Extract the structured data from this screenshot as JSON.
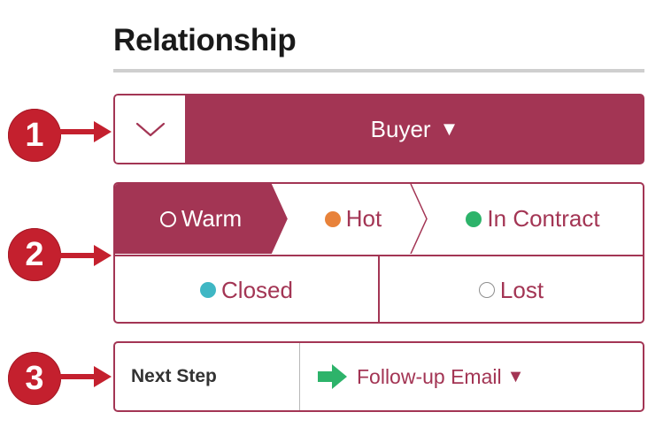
{
  "section": {
    "title": "Relationship"
  },
  "callouts": [
    "1",
    "2",
    "3"
  ],
  "relationship": {
    "role_label": "Buyer",
    "role_caret": "▼"
  },
  "status": {
    "top": [
      {
        "label": "Warm",
        "dot_color": "#a33554",
        "selected": true
      },
      {
        "label": "Hot",
        "dot_color": "#e8823a",
        "selected": false
      },
      {
        "label": "In Contract",
        "dot_color": "#2db36a",
        "selected": false
      }
    ],
    "bottom": [
      {
        "label": "Closed",
        "dot_color": "#3fb7c4",
        "selected": false
      },
      {
        "label": "Lost",
        "dot_color": "#ffffff",
        "selected": false
      }
    ]
  },
  "next_step": {
    "label": "Next Step",
    "value": "Follow-up Email",
    "caret": "▼",
    "icon": "green-arrow-icon"
  },
  "colors": {
    "accent": "#a33554",
    "callout": "#c4202e",
    "divider": "#cfcfcf"
  }
}
